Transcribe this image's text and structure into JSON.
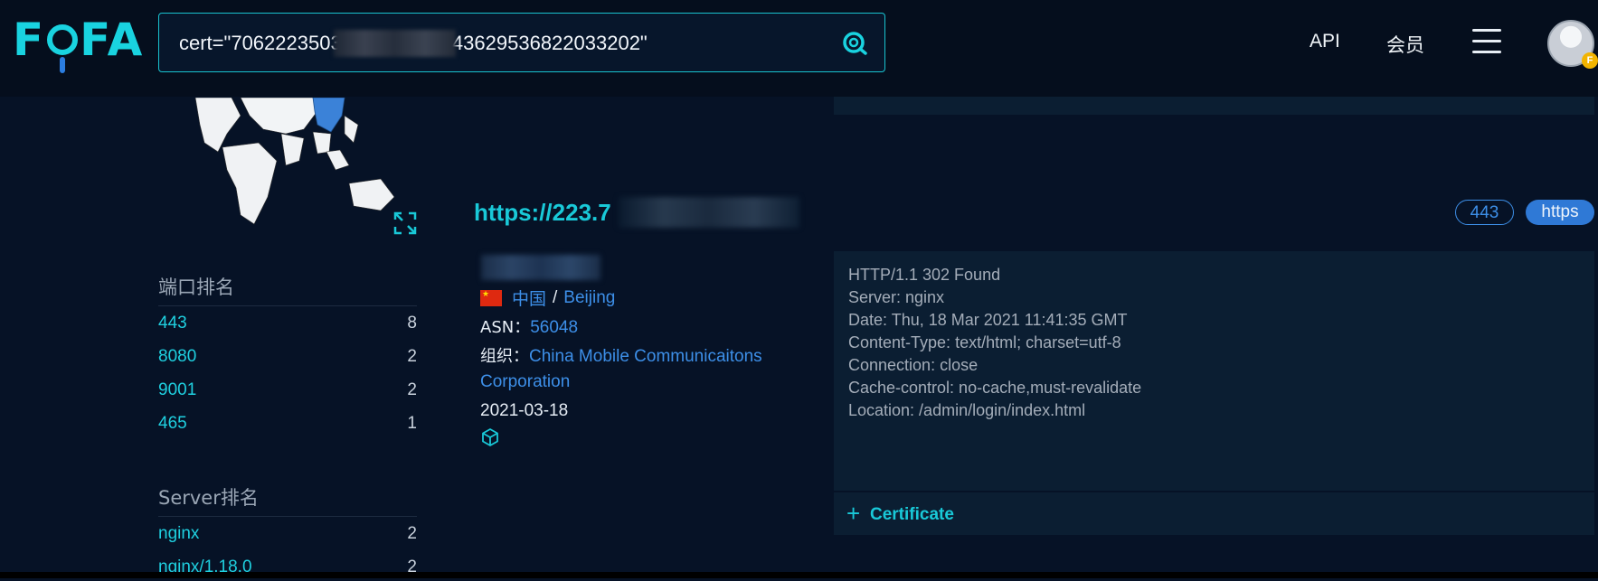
{
  "header": {
    "logo_text": "FOFA",
    "search_value": "cert=\"7062223503                    43629536822033202\"",
    "search_icon": "search-icon",
    "nav_api": "API",
    "nav_member": "会员",
    "menu_icon": "hamburger-menu-icon",
    "avatar_badge": "F"
  },
  "sidebar": {
    "port_rank_title": "端口排名",
    "port_rank": [
      {
        "key": "443",
        "count": "8"
      },
      {
        "key": "8080",
        "count": "2"
      },
      {
        "key": "9001",
        "count": "2"
      },
      {
        "key": "465",
        "count": "1"
      }
    ],
    "server_rank_title": "Server排名",
    "server_rank": [
      {
        "key": "nginx",
        "count": "2"
      },
      {
        "key": "nginx/1.18.0",
        "count": "2"
      }
    ]
  },
  "result": {
    "url": "https://223.7",
    "country": "中国",
    "separator": "/",
    "city": "Beijing",
    "asn_label": "ASN：",
    "asn": "56048",
    "org_label": "组织：",
    "org_line1": "China Mobile Communicaitons",
    "org_line2": "Corporation",
    "date": "2021-03-18",
    "port_tag": "443",
    "protocol_tag": "https",
    "http_headers": [
      "HTTP/1.1 302 Found",
      "Server: nginx",
      "Date: Thu, 18 Mar 2021 11:41:35 GMT",
      "Content-Type: text/html; charset=utf-8",
      "Connection: close",
      "Cache-control: no-cache,must-revalidate",
      "Location: /admin/login/index.html"
    ],
    "cert_label": "Certificate",
    "cert_plus": "+",
    "cert_label_top": "+ Certificate"
  },
  "colors": {
    "accent": "#19c9d8",
    "link": "#3d8fe8",
    "background": "#061226",
    "panel": "#0b1e32"
  }
}
